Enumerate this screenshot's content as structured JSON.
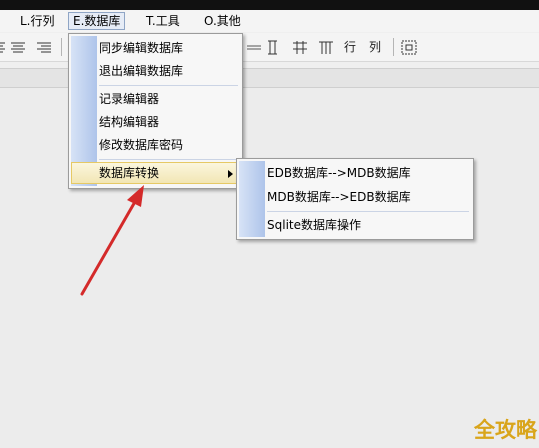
{
  "menubar": {
    "items": [
      {
        "label": "L.行列"
      },
      {
        "label": "E.数据库"
      },
      {
        "label": "T.工具"
      },
      {
        "label": "O.其他"
      }
    ]
  },
  "toolbar": {
    "left_icons": [
      "align-left-icon",
      "align-center-icon",
      "align-right-icon"
    ],
    "right_labels": [
      "行",
      "列"
    ]
  },
  "db_menu": {
    "items": [
      {
        "label": "同步编辑数据库"
      },
      {
        "label": "退出编辑数据库"
      },
      {
        "label": "记录编辑器"
      },
      {
        "label": "结构编辑器"
      },
      {
        "label": "修改数据库密码"
      },
      {
        "label": "数据库转换"
      }
    ]
  },
  "convert_submenu": {
    "items": [
      {
        "label": "EDB数据库-->MDB数据库"
      },
      {
        "label": "MDB数据库-->EDB数据库"
      },
      {
        "label": "Sqlite数据库操作"
      }
    ]
  },
  "watermark": "全攻略",
  "colors": {
    "arrow": "#d42a2a",
    "menu_highlight": "#f2e6b4",
    "gutter": "#aec4ea",
    "watermark": "#d9a51b"
  }
}
